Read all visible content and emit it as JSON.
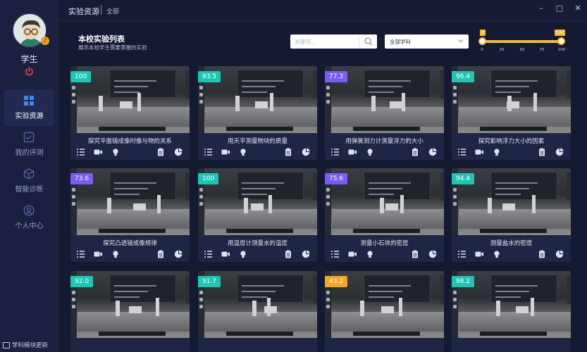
{
  "titlebar": {
    "breadcrumb_main": "实验资源",
    "breadcrumb_sub": "全部",
    "minimize": "–",
    "maximize": "□",
    "close": "✕"
  },
  "sidebar": {
    "user_name": "学生",
    "items": [
      {
        "label": "实验资源",
        "icon": "grid-icon",
        "active": true
      },
      {
        "label": "我的评测",
        "icon": "checkbox-icon",
        "active": false
      },
      {
        "label": "智能诊断",
        "icon": "cube-icon",
        "active": false
      },
      {
        "label": "个人中心",
        "icon": "user-icon",
        "active": false
      }
    ],
    "footer_label": "学科模块更新"
  },
  "header": {
    "title": "本校实验列表",
    "subtitle": "展示本校学生需要掌握的实验",
    "search_placeholder": "关键词...",
    "subject_select": "全部学科"
  },
  "score_range": {
    "min_tip": "0",
    "max_tip": "100",
    "ticks": [
      "0",
      "25",
      "50",
      "75",
      "100"
    ],
    "low": 0,
    "high": 100
  },
  "colors": {
    "badge_teal": "#20c4b4",
    "badge_purple": "#7b5cf0",
    "badge_orange": "#f5a623",
    "accent": "#f3b83a"
  },
  "cards": [
    {
      "score": "100",
      "title": "探究平面镜成像时像与物的关系",
      "badge_color": "#20c4b4"
    },
    {
      "score": "93.5",
      "title": "用天平测量物块的质量",
      "badge_color": "#20c4b4"
    },
    {
      "score": "77.3",
      "title": "用弹簧测力计测量浮力的大小",
      "badge_color": "#7b5cf0"
    },
    {
      "score": "96.4",
      "title": "探究影响浮力大小的因素",
      "badge_color": "#20c4b4"
    },
    {
      "score": "73.6",
      "title": "探究凸透镜成像规律",
      "badge_color": "#7b5cf0"
    },
    {
      "score": "100",
      "title": "用温度计测量水的温度",
      "badge_color": "#20c4b4"
    },
    {
      "score": "75.6",
      "title": "测量小石块的密度",
      "badge_color": "#7b5cf0"
    },
    {
      "score": "94.4",
      "title": "测量盐水的密度",
      "badge_color": "#20c4b4"
    },
    {
      "score": "92.0",
      "title": "",
      "badge_color": "#20c4b4"
    },
    {
      "score": "91.7",
      "title": "",
      "badge_color": "#20c4b4"
    },
    {
      "score": "43.2",
      "title": "",
      "badge_color": "#f5a623"
    },
    {
      "score": "98.2",
      "title": "",
      "badge_color": "#20c4b4"
    }
  ],
  "card_actions": [
    "list-icon",
    "video-icon",
    "bulb-icon",
    "clipboard-icon",
    "pie-chart-icon"
  ]
}
